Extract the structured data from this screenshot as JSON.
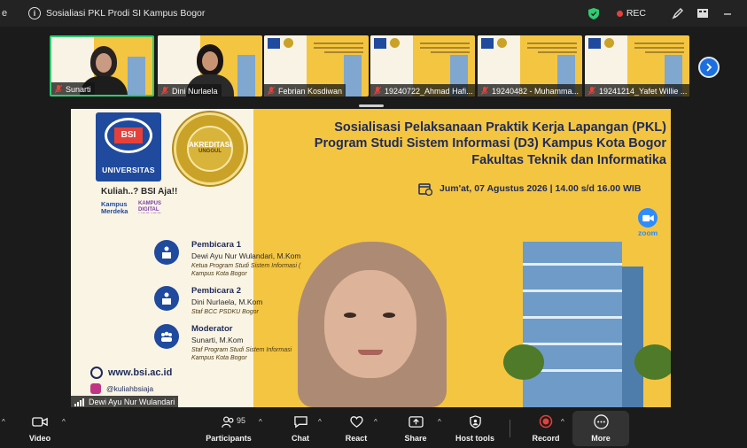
{
  "titlebar": {
    "edge_char": "e",
    "meeting_title": "Sosialiasi PKL Prodi SI Kampus Bogor",
    "rec_label": "REC"
  },
  "thumbnails": [
    {
      "name": "Sunarti",
      "active": true
    },
    {
      "name": "Dini Nurlaela",
      "active": false
    },
    {
      "name": "Febrian Kosdiwan",
      "active": false
    },
    {
      "name": "19240722_Ahmad Hafi...",
      "active": false
    },
    {
      "name": "19240482 - Muhamma...",
      "active": false
    },
    {
      "name": "19241214_Yafet Willie ...",
      "active": false
    }
  ],
  "slide": {
    "university_label": "UNIVERSITAS",
    "bsi_mark": "BSI",
    "accreditation_top": "AKREDITASI",
    "accreditation_bottom": "UNGGUL",
    "tagline": "Kuliah..? BSI Aja!!",
    "logo_kampus_merdeka": "Kampus Merdeka",
    "logo_kbk": "KAMPUS DIGITAL KREATIF",
    "title_line1": "Sosialisasi Pelaksanaan Praktik Kerja Lapangan (PKL)",
    "title_line2": "Program Studi Sistem Informasi (D3) Kampus Kota Bogor",
    "title_line3": "Fakultas Teknik dan Informatika",
    "date_text": "Jum'at, 07 Agustus 2026 | 14.00 s/d 16.00 WIB",
    "zoom_label": "zoom",
    "speakers": [
      {
        "role": "Pembicara 1",
        "name": "Dewi Ayu Nur Wulandari, M.Kom",
        "desc1": "Ketua Program Studi Sistem Informasi (",
        "desc2": "Kampus Kota Bogor"
      },
      {
        "role": "Pembicara 2",
        "name": "Dini Nurlaela, M.Kom",
        "desc1": "Staf BCC PSDKU Bogor",
        "desc2": ""
      },
      {
        "role": "Moderator",
        "name": "Sunarti, M.Kom",
        "desc1": "Staf Program Studi Sistem Informasi",
        "desc2": "Kampus Kota Bogor"
      }
    ],
    "website": "www.bsi.ac.id",
    "instagram": "@kuliahbsiaja"
  },
  "active_speaker": "Dewi Ayu Nur Wulandari",
  "toolbar": {
    "video_label": "Video",
    "participants_label": "Participants",
    "participants_count": "95",
    "chat_label": "Chat",
    "react_label": "React",
    "share_label": "Share",
    "host_tools_label": "Host tools",
    "record_label": "Record",
    "more_label": "More"
  },
  "colors": {
    "accent_green": "#2ecc71",
    "rec_red": "#e5413a",
    "next_blue": "#1c6fe0",
    "slide_yellow": "#f4c541",
    "brand_blue": "#1f4a9e"
  }
}
